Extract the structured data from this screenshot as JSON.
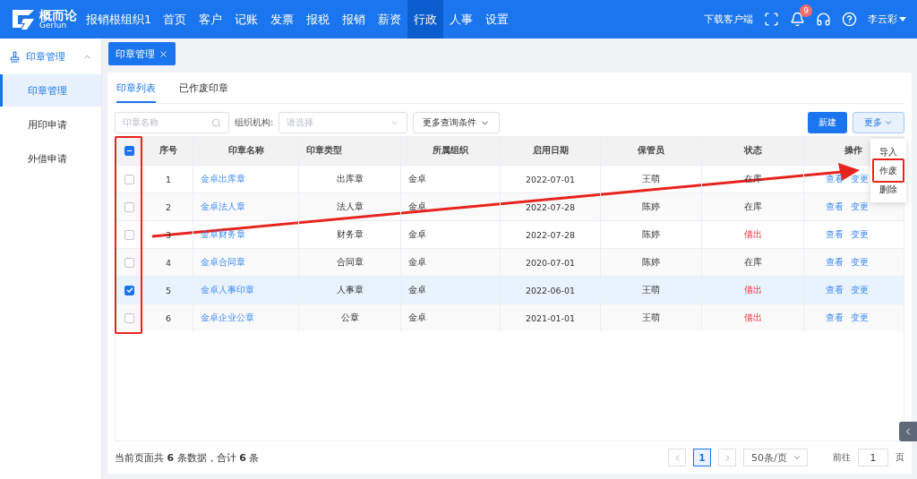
{
  "topbar": {
    "logo_name": "概而论",
    "logo_sub": "Gerlun",
    "org": "报销根组织1",
    "nav": [
      {
        "label": "首页",
        "selected": false
      },
      {
        "label": "客户",
        "selected": false
      },
      {
        "label": "记账",
        "selected": false
      },
      {
        "label": "发票",
        "selected": false
      },
      {
        "label": "报税",
        "selected": false
      },
      {
        "label": "报销",
        "selected": false
      },
      {
        "label": "薪资",
        "selected": false
      },
      {
        "label": "行政",
        "selected": true
      },
      {
        "label": "人事",
        "selected": false
      },
      {
        "label": "设置",
        "selected": false
      }
    ],
    "download": "下载客户端",
    "notifications": "9",
    "user": "李云彩"
  },
  "sidebar": {
    "group": "印章管理",
    "expanded": true,
    "items": [
      {
        "label": "印章管理",
        "selected": true
      },
      {
        "label": "用印申请",
        "selected": false
      },
      {
        "label": "外借申请",
        "selected": false
      }
    ]
  },
  "open_tab": "印章管理",
  "tabs": [
    {
      "label": "印章列表",
      "selected": true
    },
    {
      "label": "已作废印章",
      "selected": false
    }
  ],
  "filters": {
    "name_placeholder": "印章名称",
    "org_label": "组织机构:",
    "org_placeholder": "请选择",
    "more": "更多查询条件"
  },
  "actions": {
    "new": "新建",
    "more": "更多"
  },
  "menu": [
    "导入",
    "作废",
    "删除"
  ],
  "table": {
    "columns": [
      "序号",
      "印章名称",
      "印章类型",
      "所属组织",
      "启用日期",
      "保管员",
      "状态",
      "操作"
    ],
    "header_checked": true,
    "rows": [
      {
        "checked": false,
        "no": "1",
        "name": "金卓出库章",
        "type": "出库章",
        "org": "金卓",
        "date": "2022-07-01",
        "keeper": "王萌",
        "status": {
          "text": "在库",
          "kind": "normal"
        },
        "ops": [
          "查看",
          "变更"
        ]
      },
      {
        "checked": false,
        "no": "2",
        "name": "金卓法人章",
        "type": "法人章",
        "org": "金卓",
        "date": "2022-07-28",
        "keeper": "陈婷",
        "status": {
          "text": "在库",
          "kind": "normal"
        },
        "ops": [
          "查看",
          "变更"
        ]
      },
      {
        "checked": false,
        "no": "3",
        "name": "金卓财务章",
        "type": "财务章",
        "org": "金卓",
        "date": "2022-07-28",
        "keeper": "陈婷",
        "status": {
          "text": "借出",
          "kind": "warning"
        },
        "ops": [
          "查看",
          "变更"
        ]
      },
      {
        "checked": false,
        "no": "4",
        "name": "金卓合同章",
        "type": "合同章",
        "org": "金卓",
        "date": "2020-07-01",
        "keeper": "陈婷",
        "status": {
          "text": "在库",
          "kind": "normal"
        },
        "ops": [
          "查看",
          "变更"
        ]
      },
      {
        "checked": true,
        "no": "5",
        "name": "金卓人事印章",
        "type": "人事章",
        "org": "金卓",
        "date": "2022-06-01",
        "keeper": "王萌",
        "status": {
          "text": "借出",
          "kind": "warning"
        },
        "ops": [
          "查看",
          "变更"
        ]
      },
      {
        "checked": false,
        "no": "6",
        "name": "金卓企业公章",
        "type": "公章",
        "org": "金卓",
        "date": "2021-01-01",
        "keeper": "王萌",
        "status": {
          "text": "借出",
          "kind": "warning"
        },
        "ops": [
          "查看",
          "变更"
        ]
      }
    ]
  },
  "footer": {
    "summary": "当前页面共 **6** 条数据，合计 **6** 条",
    "page": "1",
    "page_size": "50条/页",
    "goto_label": "前往",
    "goto_value": "1",
    "goto_unit": "页"
  },
  "annotations": [
    {
      "kind": "box"
    },
    {
      "kind": "arrow"
    },
    {
      "kind": "menu-box"
    }
  ]
}
